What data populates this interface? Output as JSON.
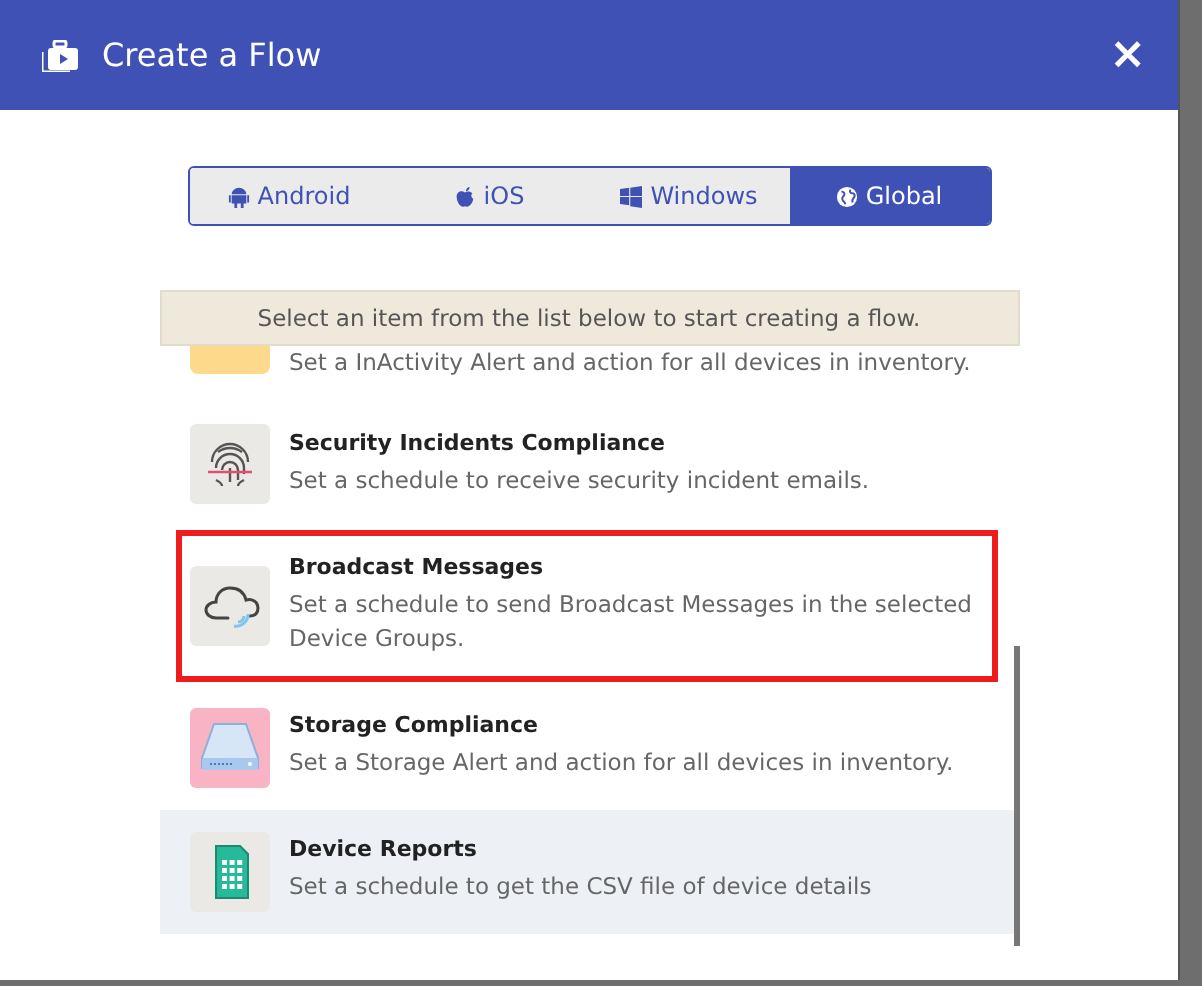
{
  "window": {
    "title": "Create a Flow",
    "close": "×"
  },
  "tabs": [
    {
      "label": "Android",
      "kind": "android",
      "selected": false
    },
    {
      "label": "iOS",
      "kind": "apple",
      "selected": false
    },
    {
      "label": "Windows",
      "kind": "windows",
      "selected": false
    },
    {
      "label": "Global",
      "kind": "globe",
      "selected": true
    }
  ],
  "notice": "Select an item from the list below to start creating a flow.",
  "flows": [
    {
      "kind": "inactivity",
      "description": "Set a InActivity Alert and action for all devices in inventory.",
      "highlighted": false,
      "hovered": false
    },
    {
      "kind": "fingerprint",
      "title": "Security Incidents Compliance",
      "description": "Set a schedule to receive security incident emails.",
      "highlighted": false,
      "hovered": false
    },
    {
      "kind": "cloud",
      "title": "Broadcast Messages",
      "description": "Set a schedule to send Broadcast Messages in the selected Device Groups.",
      "highlighted": true,
      "hovered": false
    },
    {
      "kind": "storage",
      "title": "Storage Compliance",
      "description": "Set a Storage Alert and action for all devices in inventory.",
      "highlighted": false,
      "hovered": false
    },
    {
      "kind": "report",
      "title": "Device Reports",
      "description": "Set a schedule to get the CSV file of device details",
      "highlighted": false,
      "hovered": true
    }
  ]
}
